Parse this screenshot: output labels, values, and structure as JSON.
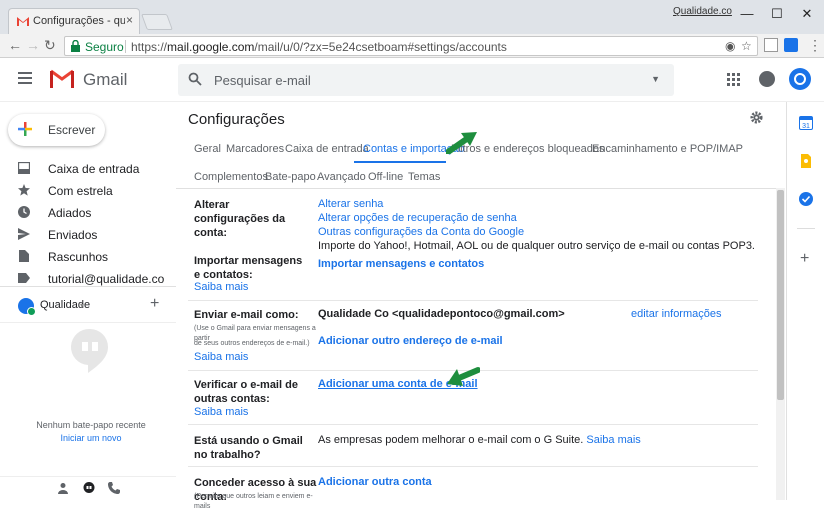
{
  "browser": {
    "tab_title": "Configurações - qualidade",
    "tab_close": "×",
    "profile_name": "Qualidade.co",
    "secure_label": "Seguro",
    "url_scheme": "https://",
    "url_host": "mail.google.com",
    "url_path": "/mail/u/0/?zx=5e24csetboam#settings/accounts",
    "window_controls": [
      "—",
      "☐",
      "✕"
    ]
  },
  "header": {
    "app_name": "Gmail",
    "search_placeholder": "Pesquisar e-mail"
  },
  "sidebar": {
    "compose_label": "Escrever",
    "items": [
      {
        "label": "Caixa de entrada",
        "icon": "inbox-icon"
      },
      {
        "label": "Com estrela",
        "icon": "star-icon"
      },
      {
        "label": "Adiados",
        "icon": "clock-icon"
      },
      {
        "label": "Enviados",
        "icon": "send-icon"
      },
      {
        "label": "Rascunhos",
        "icon": "draft-icon"
      },
      {
        "label": "tutorial@qualidade.co",
        "icon": "label-icon"
      }
    ],
    "hangouts_user": "Qualidade",
    "hangouts_caret": "▾",
    "hangouts_add": "+",
    "no_chat_text": "Nenhum bate-papo recente",
    "start_chat_link": "Iniciar um novo"
  },
  "settings": {
    "title": "Configurações",
    "tabs_row1": [
      "Geral",
      "Marcadores",
      "Caixa de entrada",
      "Contas e importação",
      "Filtros e endereços bloqueados",
      "Encaminhamento e POP/IMAP"
    ],
    "tabs_row2": [
      "Complementos",
      "Bate-papo",
      "Avançado",
      "Off-line",
      "Temas"
    ],
    "active_tab": "Contas e importação",
    "rows": {
      "change_account": {
        "label": "Alterar configurações da conta:",
        "links": [
          "Alterar senha",
          "Alterar opções de recuperação de senha",
          "Outras configurações da Conta do Google"
        ]
      },
      "import": {
        "label": "Importar mensagens e contatos:",
        "learn_more": "Saiba mais",
        "description": "Importe do Yahoo!, Hotmail, AOL ou de qualquer outro serviço de e-mail ou contas POP3.",
        "action": "Importar mensagens e contatos"
      },
      "send_as": {
        "label": "Enviar e-mail como:",
        "sub1": "(Use o Gmail para enviar mensagens a partir",
        "sub2": "de seus outros endereços de e-mail.)",
        "learn_more": "Saiba mais",
        "address": "Qualidade Co <qualidadepontoco@gmail.com>",
        "edit_link": "editar informações",
        "add_link": "Adicionar outro endereço de e-mail"
      },
      "check_mail": {
        "label": "Verificar o e-mail de outras contas:",
        "learn_more": "Saiba mais",
        "add_link": "Adicionar uma conta de e-mail"
      },
      "work": {
        "label": "Está usando o Gmail no trabalho?",
        "text": "As empresas podem melhorar o e-mail com o G Suite.",
        "learn_more": "Saiba mais"
      },
      "grant_access": {
        "label": "Conceder acesso à sua conta:",
        "sub": "(Permite que outros leiam e enviem e-mails",
        "add_link": "Adicionar outra conta"
      }
    }
  },
  "colors": {
    "accent": "#1a73e8",
    "arrow": "#1e8e3e",
    "gmail_red": "#ea4335"
  }
}
